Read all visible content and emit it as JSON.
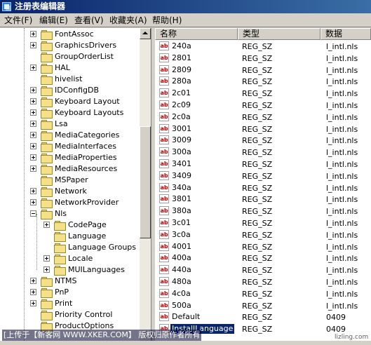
{
  "window": {
    "title": "注册表编辑器"
  },
  "menu": [
    "文件(F)",
    "编辑(E)",
    "查看(V)",
    "收藏夹(A)",
    "帮助(H)"
  ],
  "tree": {
    "items": [
      {
        "label": "FontAssoc",
        "expander": "plus"
      },
      {
        "label": "GraphicsDrivers",
        "expander": "plus"
      },
      {
        "label": "GroupOrderList",
        "expander": "none"
      },
      {
        "label": "HAL",
        "expander": "plus"
      },
      {
        "label": "hivelist",
        "expander": "none"
      },
      {
        "label": "IDConfigDB",
        "expander": "plus"
      },
      {
        "label": "Keyboard Layout",
        "expander": "plus"
      },
      {
        "label": "Keyboard Layouts",
        "expander": "plus"
      },
      {
        "label": "Lsa",
        "expander": "plus"
      },
      {
        "label": "MediaCategories",
        "expander": "plus"
      },
      {
        "label": "MediaInterfaces",
        "expander": "plus"
      },
      {
        "label": "MediaProperties",
        "expander": "plus"
      },
      {
        "label": "MediaResources",
        "expander": "plus"
      },
      {
        "label": "MSPaper",
        "expander": "none"
      },
      {
        "label": "Network",
        "expander": "plus"
      },
      {
        "label": "NetworkProvider",
        "expander": "plus"
      },
      {
        "label": "Nls",
        "expander": "minus"
      },
      {
        "label": "CodePage",
        "expander": "plus",
        "child": true
      },
      {
        "label": "Language",
        "expander": "none",
        "child": true
      },
      {
        "label": "Language Groups",
        "expander": "none",
        "child": true
      },
      {
        "label": "Locale",
        "expander": "plus",
        "child": true
      },
      {
        "label": "MUILanguages",
        "expander": "plus",
        "child": true
      },
      {
        "label": "NTMS",
        "expander": "plus"
      },
      {
        "label": "PnP",
        "expander": "plus"
      },
      {
        "label": "Print",
        "expander": "plus"
      },
      {
        "label": "Priority Control",
        "expander": "none"
      },
      {
        "label": "ProductOptions",
        "expander": "none"
      }
    ]
  },
  "list": {
    "columns": [
      "名称",
      "类型",
      "数据"
    ],
    "rows": [
      {
        "name": "240a",
        "type": "REG_SZ",
        "data": "l_intl.nls"
      },
      {
        "name": "2801",
        "type": "REG_SZ",
        "data": "l_intl.nls"
      },
      {
        "name": "2809",
        "type": "REG_SZ",
        "data": "l_intl.nls"
      },
      {
        "name": "280a",
        "type": "REG_SZ",
        "data": "l_intl.nls"
      },
      {
        "name": "2c01",
        "type": "REG_SZ",
        "data": "l_intl.nls"
      },
      {
        "name": "2c09",
        "type": "REG_SZ",
        "data": "l_intl.nls"
      },
      {
        "name": "2c0a",
        "type": "REG_SZ",
        "data": "l_intl.nls"
      },
      {
        "name": "3001",
        "type": "REG_SZ",
        "data": "l_intl.nls"
      },
      {
        "name": "3009",
        "type": "REG_SZ",
        "data": "l_intl.nls"
      },
      {
        "name": "300a",
        "type": "REG_SZ",
        "data": "l_intl.nls"
      },
      {
        "name": "3401",
        "type": "REG_SZ",
        "data": "l_intl.nls"
      },
      {
        "name": "3409",
        "type": "REG_SZ",
        "data": "l_intl.nls"
      },
      {
        "name": "340a",
        "type": "REG_SZ",
        "data": "l_intl.nls"
      },
      {
        "name": "3801",
        "type": "REG_SZ",
        "data": "l_intl.nls"
      },
      {
        "name": "380a",
        "type": "REG_SZ",
        "data": "l_intl.nls"
      },
      {
        "name": "3c01",
        "type": "REG_SZ",
        "data": "l_intl.nls"
      },
      {
        "name": "3c0a",
        "type": "REG_SZ",
        "data": "l_intl.nls"
      },
      {
        "name": "4001",
        "type": "REG_SZ",
        "data": "l_intl.nls"
      },
      {
        "name": "400a",
        "type": "REG_SZ",
        "data": "l_intl.nls"
      },
      {
        "name": "440a",
        "type": "REG_SZ",
        "data": "l_intl.nls"
      },
      {
        "name": "480a",
        "type": "REG_SZ",
        "data": "l_intl.nls"
      },
      {
        "name": "4c0a",
        "type": "REG_SZ",
        "data": "l_intl.nls"
      },
      {
        "name": "500a",
        "type": "REG_SZ",
        "data": "l_intl.nls"
      },
      {
        "name": "Default",
        "type": "REG_SZ",
        "data": "0409"
      },
      {
        "name": "InstallLanguage",
        "type": "REG_SZ",
        "data": "0409",
        "selected": true
      }
    ]
  },
  "icons": {
    "value": "ab"
  },
  "watermark": "[上传于【新客网 WWW.XKER.COM】 版权归原作者所有",
  "corner_mark": "lizling.com"
}
